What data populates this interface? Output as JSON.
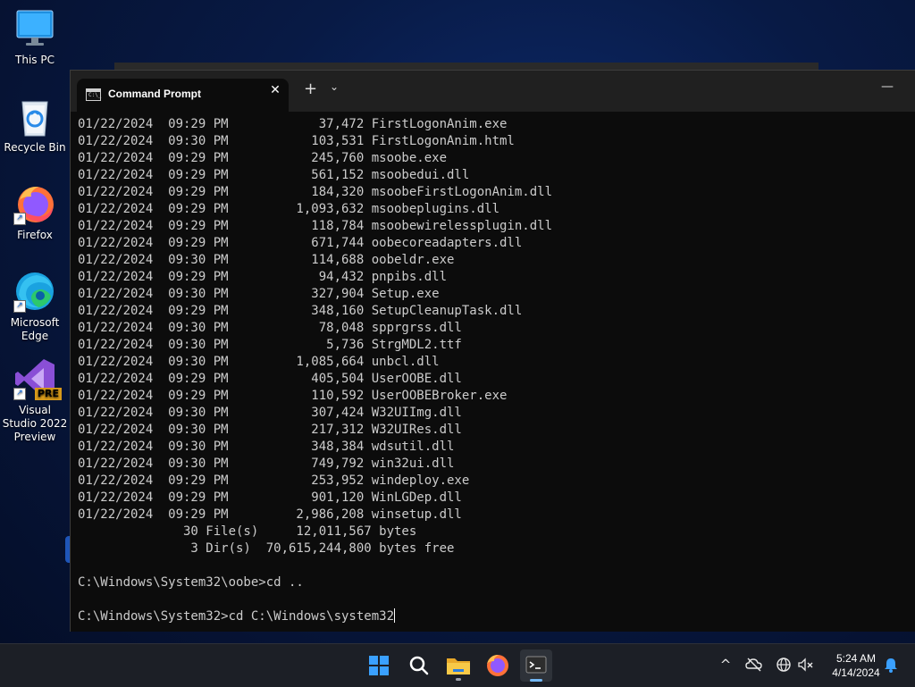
{
  "desktop": {
    "icons": [
      {
        "label": "This PC"
      },
      {
        "label": "Recycle Bin"
      },
      {
        "label": "Firefox"
      },
      {
        "label": "Microsoft Edge"
      },
      {
        "label": "Visual Studio 2022 Preview",
        "badge": "PRE"
      }
    ]
  },
  "terminal": {
    "tab_title": "Command Prompt",
    "close_glyph": "✕",
    "new_tab_glyph": "+",
    "dropdown_glyph": "⌄",
    "minimize_glyph": "—",
    "lines": [
      "01/22/2024  09:29 PM            37,472 FirstLogonAnim.exe",
      "01/22/2024  09:30 PM           103,531 FirstLogonAnim.html",
      "01/22/2024  09:29 PM           245,760 msoobe.exe",
      "01/22/2024  09:29 PM           561,152 msoobedui.dll",
      "01/22/2024  09:29 PM           184,320 msoobeFirstLogonAnim.dll",
      "01/22/2024  09:29 PM         1,093,632 msoobeplugins.dll",
      "01/22/2024  09:29 PM           118,784 msoobewirelessplugin.dll",
      "01/22/2024  09:29 PM           671,744 oobecoreadapters.dll",
      "01/22/2024  09:30 PM           114,688 oobeldr.exe",
      "01/22/2024  09:29 PM            94,432 pnpibs.dll",
      "01/22/2024  09:30 PM           327,904 Setup.exe",
      "01/22/2024  09:29 PM           348,160 SetupCleanupTask.dll",
      "01/22/2024  09:30 PM            78,048 spprgrss.dll",
      "01/22/2024  09:30 PM             5,736 StrgMDL2.ttf",
      "01/22/2024  09:30 PM         1,085,664 unbcl.dll",
      "01/22/2024  09:29 PM           405,504 UserOOBE.dll",
      "01/22/2024  09:29 PM           110,592 UserOOBEBroker.exe",
      "01/22/2024  09:30 PM           307,424 W32UIImg.dll",
      "01/22/2024  09:30 PM           217,312 W32UIRes.dll",
      "01/22/2024  09:30 PM           348,384 wdsutil.dll",
      "01/22/2024  09:30 PM           749,792 win32ui.dll",
      "01/22/2024  09:29 PM           253,952 windeploy.exe",
      "01/22/2024  09:29 PM           901,120 WinLGDep.dll",
      "01/22/2024  09:29 PM         2,986,208 winsetup.dll",
      "              30 File(s)     12,011,567 bytes",
      "               3 Dir(s)  70,615,244,800 bytes free",
      "",
      "C:\\Windows\\System32\\oobe>cd ..",
      ""
    ],
    "current_input": "C:\\Windows\\System32>cd C:\\Windows\\system32"
  },
  "taskbar": {
    "apps": [
      {
        "name": "Start"
      },
      {
        "name": "Search"
      },
      {
        "name": "File Explorer"
      },
      {
        "name": "Firefox"
      },
      {
        "name": "Terminal"
      }
    ],
    "tray": {
      "chevron": "^",
      "time": "5:24 AM",
      "date": "4/14/2024"
    }
  },
  "colors": {
    "console_bg": "#0c0c0c",
    "console_text": "#cccccc",
    "titlebar_bg": "#202020",
    "taskbar_bg": "#1c1f26",
    "accent": "#74b8f4"
  }
}
